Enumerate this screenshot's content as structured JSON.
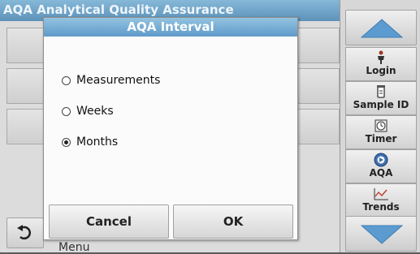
{
  "background": {
    "header_title": "AQA   Analytical Quality Assurance",
    "menu_label": "Menu"
  },
  "dialog": {
    "title": "AQA Interval",
    "options": [
      {
        "label": "Measurements",
        "checked": false
      },
      {
        "label": "Weeks",
        "checked": false
      },
      {
        "label": "Months",
        "checked": true
      }
    ],
    "cancel_label": "Cancel",
    "ok_label": "OK"
  },
  "sidebar": {
    "items": [
      {
        "label": "Login",
        "icon": "person-icon"
      },
      {
        "label": "Sample ID",
        "icon": "vial-icon"
      },
      {
        "label": "Timer",
        "icon": "timer-icon"
      },
      {
        "label": "AQA",
        "icon": "aqa-icon"
      },
      {
        "label": "Trends",
        "icon": "trends-icon"
      }
    ]
  },
  "colors": {
    "title_bar": "#6fa6d0",
    "background": "#dcdcdc",
    "arrow": "#4f86bd"
  }
}
